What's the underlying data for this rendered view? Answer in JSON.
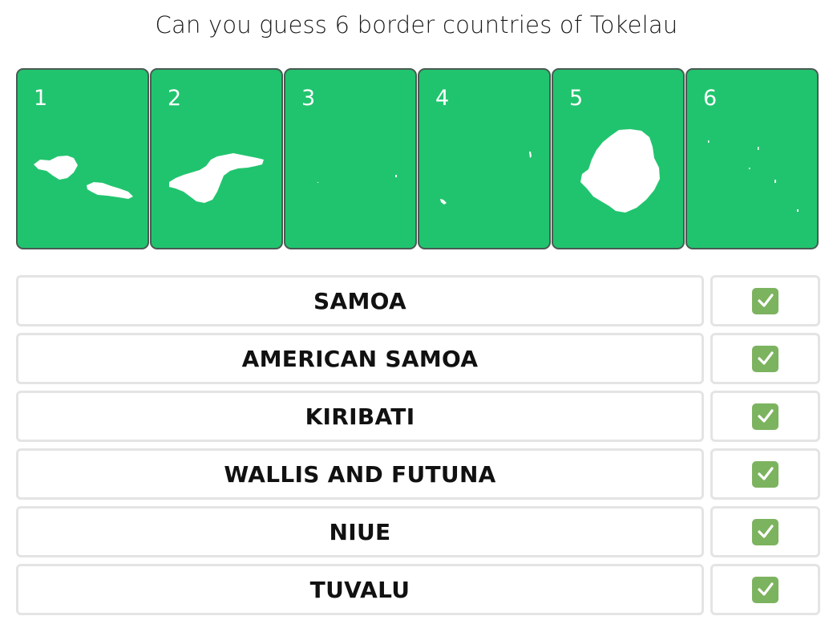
{
  "title": "Can you guess 6 border countries of Tokelau",
  "cards": [
    {
      "number": "1",
      "shape": "samoa"
    },
    {
      "number": "2",
      "shape": "american-samoa"
    },
    {
      "number": "3",
      "shape": "kiribati"
    },
    {
      "number": "4",
      "shape": "wallis-and-futuna"
    },
    {
      "number": "5",
      "shape": "niue"
    },
    {
      "number": "6",
      "shape": "tuvalu"
    }
  ],
  "answers": [
    {
      "name": "SAMOA",
      "status": "correct",
      "status_icon": "checkmark-icon"
    },
    {
      "name": "AMERICAN SAMOA",
      "status": "correct",
      "status_icon": "checkmark-icon"
    },
    {
      "name": "KIRIBATI",
      "status": "correct",
      "status_icon": "checkmark-icon"
    },
    {
      "name": "WALLIS AND FUTUNA",
      "status": "correct",
      "status_icon": "checkmark-icon"
    },
    {
      "name": "NIUE",
      "status": "correct",
      "status_icon": "checkmark-icon"
    },
    {
      "name": "TUVALU",
      "status": "correct",
      "status_icon": "checkmark-icon"
    }
  ],
  "colors": {
    "card_fill": "#21c46e",
    "card_border": "#4a5a52",
    "check_fill": "#7cb35f",
    "row_border": "#e4e4e4"
  }
}
